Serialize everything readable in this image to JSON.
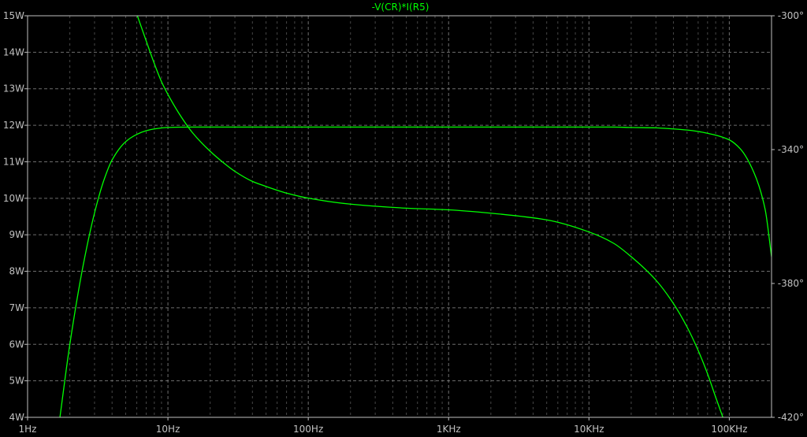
{
  "chart_data": {
    "type": "line",
    "title": "-V(CR)*I(R5)",
    "x_scale": "log",
    "x_range_hz": [
      1,
      200000
    ],
    "x_tick_values": [
      1,
      10,
      100,
      1000,
      10000,
      100000
    ],
    "x_tick_labels": [
      "1Hz",
      "10Hz",
      "100Hz",
      "1KHz",
      "10KHz",
      "100KHz"
    ],
    "y_left_range_w": [
      4,
      15
    ],
    "y_left_ticks": [
      4,
      5,
      6,
      7,
      8,
      9,
      10,
      11,
      12,
      13,
      14,
      15
    ],
    "y_left_tick_labels": [
      "4W",
      "5W",
      "6W",
      "7W",
      "8W",
      "9W",
      "10W",
      "11W",
      "12W",
      "13W",
      "14W",
      "15W"
    ],
    "y_right_range_deg": [
      -420,
      -300
    ],
    "y_right_ticks": [
      -300,
      -340,
      -380,
      -420
    ],
    "y_right_tick_labels": [
      "-300°",
      "-340°",
      "-380°",
      "-420°"
    ],
    "grid": true,
    "colors": {
      "background": "#000000",
      "trace": "#00ff00",
      "grid": "#808080",
      "frame": "#c0c0c0",
      "text": "#c0c0c0"
    },
    "series": [
      {
        "name": "-V(CR)*I(R5)",
        "axis": "left",
        "unit": "W",
        "x": [
          1.7,
          2.0,
          2.5,
          3.0,
          3.5,
          4.0,
          5.0,
          6.0,
          7.0,
          8.0,
          10,
          15,
          20,
          50,
          100,
          1000,
          10000,
          15000,
          20000,
          30000,
          40000,
          50000,
          60000,
          70000,
          80000,
          100000,
          120000,
          150000,
          180000,
          200000
        ],
        "y": [
          4.0,
          6.0,
          8.2,
          9.6,
          10.5,
          11.05,
          11.55,
          11.75,
          11.85,
          11.9,
          11.94,
          11.95,
          11.95,
          11.95,
          11.95,
          11.95,
          11.95,
          11.95,
          11.94,
          11.93,
          11.9,
          11.87,
          11.83,
          11.78,
          11.73,
          11.6,
          11.35,
          10.7,
          9.7,
          8.4
        ]
      },
      {
        "name": "",
        "axis": "right",
        "unit": "°",
        "x": [
          6,
          7,
          8,
          9,
          10,
          12,
          15,
          20,
          25,
          30,
          40,
          50,
          70,
          100,
          200,
          500,
          1000,
          2000,
          5000,
          10000,
          15000,
          20000,
          30000,
          40000,
          50000,
          60000,
          70000,
          80000,
          90000
        ],
        "y": [
          -299.5,
          -307.5,
          -314.3,
          -319.7,
          -323.5,
          -329.2,
          -335.0,
          -340.5,
          -344.0,
          -346.5,
          -349.5,
          -351.0,
          -353.0,
          -354.5,
          -356.3,
          -357.5,
          -358.0,
          -359.0,
          -361.0,
          -364.6,
          -368.0,
          -372.0,
          -379.0,
          -386.0,
          -393.0,
          -400.0,
          -407.0,
          -414.0,
          -420.0
        ]
      }
    ]
  }
}
